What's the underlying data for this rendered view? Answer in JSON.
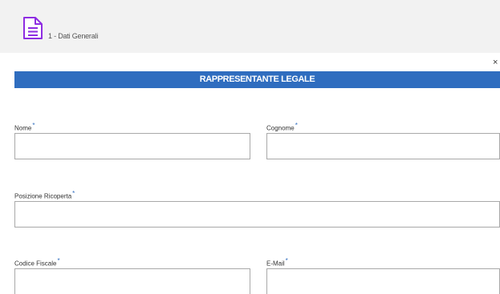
{
  "topbar": {
    "icon": "document-icon",
    "step_label": "1 - Dati Generali",
    "accent_color": "#8e2de2"
  },
  "dialog": {
    "close_glyph": "×",
    "section_title": "RAPPRESENTANTE LEGALE",
    "header_color": "#2f6dbf"
  },
  "form": {
    "nome": {
      "label": "Nome",
      "required_marker": "*",
      "value": ""
    },
    "cognome": {
      "label": "Cognome",
      "required_marker": "*",
      "value": ""
    },
    "posizione": {
      "label": "Posizione Ricoperta",
      "required_marker": "*",
      "value": ""
    },
    "codice_fiscale": {
      "label": "Codice Fiscale",
      "required_marker": "*",
      "value": ""
    },
    "email": {
      "label": "E-Mail",
      "required_marker": "*",
      "value": ""
    }
  }
}
